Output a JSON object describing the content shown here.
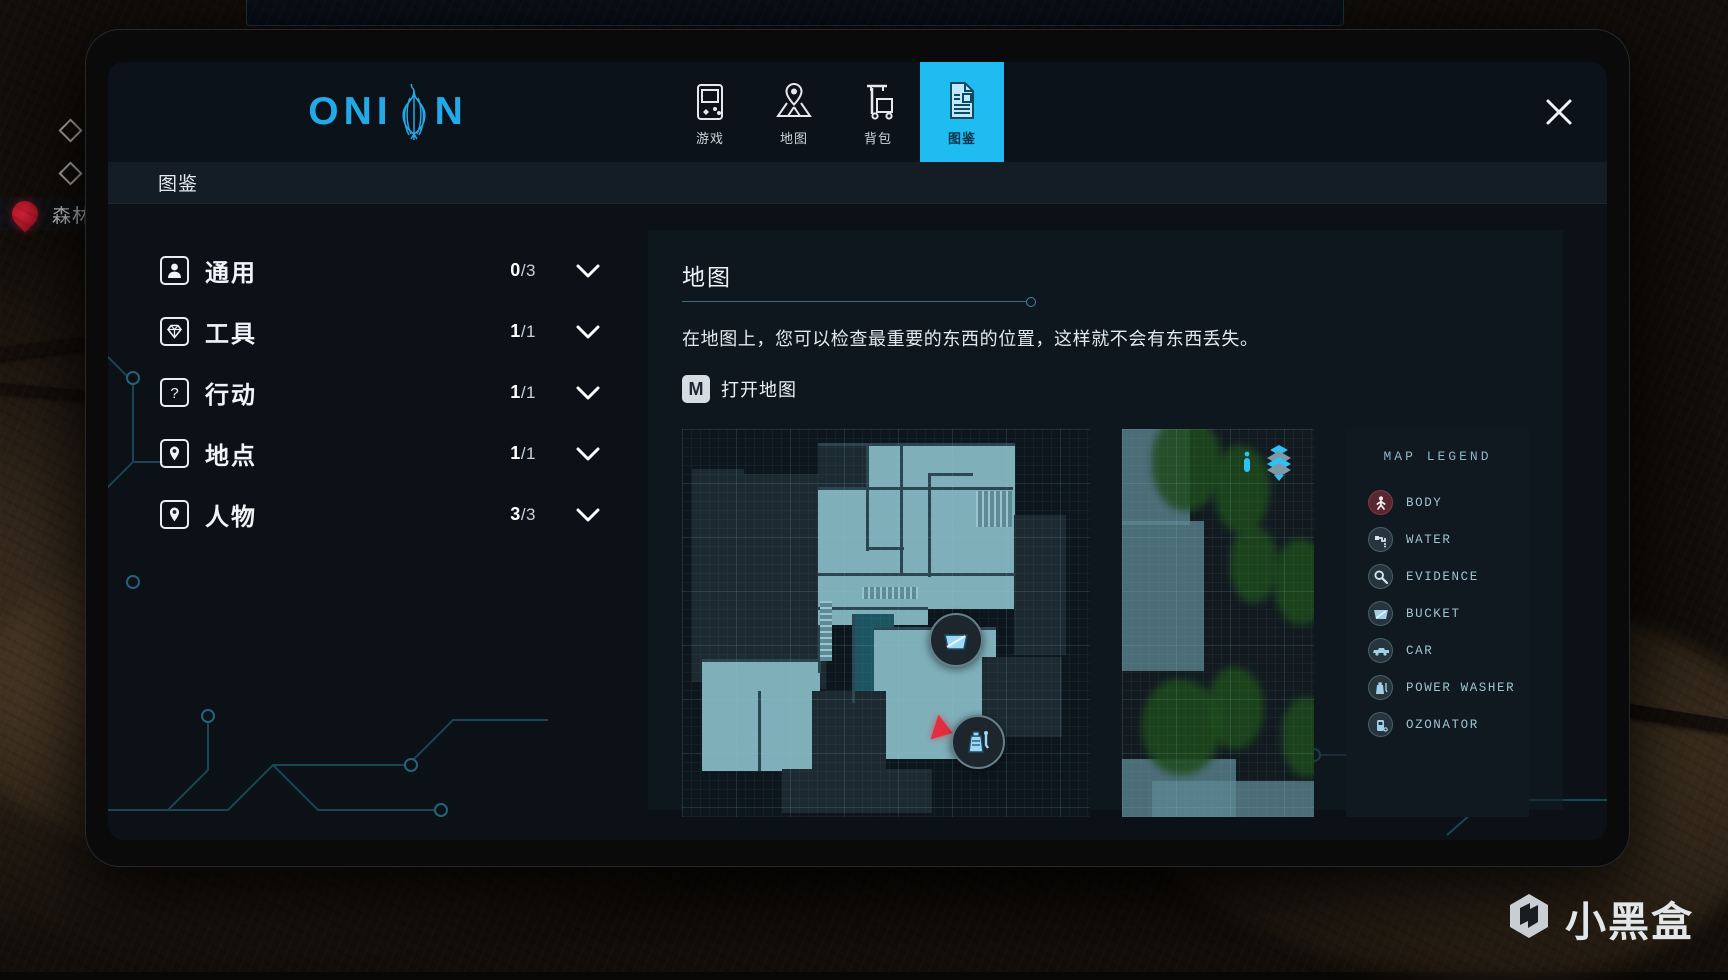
{
  "app": {
    "brand": "ONION",
    "brand_left": "ONI",
    "brand_right": "N",
    "logo_icon": "onion-bulb-icon"
  },
  "device": {
    "camera_slider_icon": "camera-privacy-slider-icon"
  },
  "tabs": [
    {
      "id": "game",
      "label": "游戏",
      "icon": "handheld-console-icon",
      "active": false
    },
    {
      "id": "map",
      "label": "地图",
      "icon": "map-pin-icon",
      "active": false
    },
    {
      "id": "backpack",
      "label": "背包",
      "icon": "cart-trolley-icon",
      "active": false
    },
    {
      "id": "codex",
      "label": "图鉴",
      "icon": "document-page-icon",
      "active": true
    }
  ],
  "close_button": {
    "icon": "close-x-icon",
    "label": "×"
  },
  "subheader": {
    "title": "图鉴"
  },
  "sidebar": {
    "items": [
      {
        "label": "通用",
        "icon": "person-card-icon",
        "current": "0",
        "total": "/3",
        "chevron": "chevron-down-icon"
      },
      {
        "label": "工具",
        "icon": "gem-diamond-icon",
        "current": "1",
        "total": "/1",
        "chevron": "chevron-down-icon"
      },
      {
        "label": "行动",
        "icon": "question-mark-icon",
        "current": "1",
        "total": "/1",
        "chevron": "chevron-down-icon"
      },
      {
        "label": "地点",
        "icon": "location-pin-icon",
        "current": "1",
        "total": "/1",
        "chevron": "chevron-down-icon"
      },
      {
        "label": "人物",
        "icon": "location-pin-icon",
        "current": "3",
        "total": "/3",
        "chevron": "chevron-down-icon"
      }
    ]
  },
  "detail": {
    "title": "地图",
    "description": "在地图上，您可以检查最重要的东西的位置，这样就不会有东西丢失。",
    "hint_key": "M",
    "hint_text": "打开地图",
    "map": {
      "layer_control_icon": "map-layers-icon",
      "player_marker_icon": "player-arrow-icon",
      "pins": [
        {
          "icon": "bucket-icon"
        },
        {
          "icon": "power-washer-icon"
        }
      ]
    },
    "legend": {
      "title": "MAP LEGEND",
      "entries": [
        {
          "label": "BODY",
          "icon": "body-icon"
        },
        {
          "label": "WATER",
          "icon": "faucet-icon"
        },
        {
          "label": "EVIDENCE",
          "icon": "magnifier-icon"
        },
        {
          "label": "BUCKET",
          "icon": "bucket-icon"
        },
        {
          "label": "CAR",
          "icon": "car-icon"
        },
        {
          "label": "POWER WASHER",
          "icon": "power-washer-icon"
        },
        {
          "label": "OZONATOR",
          "icon": "ozonator-icon"
        }
      ]
    }
  },
  "background_hud": {
    "location_label": "森林",
    "pin_icon": "red-location-pin-icon",
    "diamond_icon": "diamond-marker-icon"
  },
  "watermark": {
    "text": "小黑盒",
    "logo_icon": "xiaoheihe-logo-icon"
  },
  "colors": {
    "accent_cyan": "#1fbcf2",
    "brand_blue": "#22a9e8",
    "panel_bg": "#0b1117",
    "legend_text": "#9ec4d2",
    "map_room": "#7fb0ba",
    "player_red": "#e12f3f"
  }
}
